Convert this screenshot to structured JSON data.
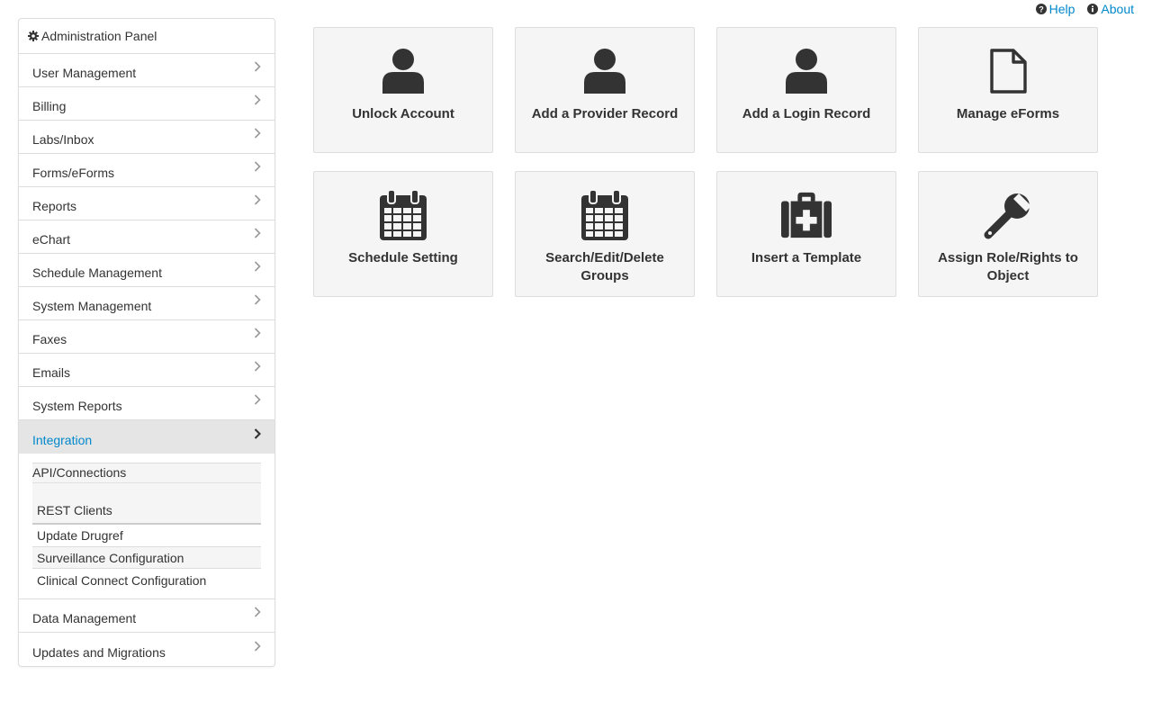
{
  "top_links": {
    "help": "Help",
    "about": "About"
  },
  "sidebar": {
    "heading": "Administration Panel",
    "items": [
      {
        "label": "User Management"
      },
      {
        "label": "Billing"
      },
      {
        "label": "Labs/Inbox"
      },
      {
        "label": "Forms/eForms"
      },
      {
        "label": "Reports"
      },
      {
        "label": "eChart"
      },
      {
        "label": "Schedule Management"
      },
      {
        "label": "System Management"
      },
      {
        "label": "Faxes"
      },
      {
        "label": "Emails"
      },
      {
        "label": "System Reports"
      },
      {
        "label": "Integration"
      },
      {
        "label": "Data Management"
      },
      {
        "label": "Updates and Migrations"
      }
    ],
    "integration_submenu": {
      "group_title": "API/Connections",
      "group_link": "REST Clients",
      "items": [
        "Update Drugref",
        "Surveillance Configuration",
        "Clinical Connect Configuration"
      ]
    }
  },
  "tiles": [
    {
      "label": "Unlock Account",
      "icon": "user-icon"
    },
    {
      "label": "Add a Provider Record",
      "icon": "user-icon"
    },
    {
      "label": "Add a Login Record",
      "icon": "user-icon"
    },
    {
      "label": "Manage eForms",
      "icon": "file-icon"
    },
    {
      "label": "Schedule Setting",
      "icon": "calendar-icon"
    },
    {
      "label": "Search/Edit/Delete Groups",
      "icon": "calendar-icon"
    },
    {
      "label": "Insert a Template",
      "icon": "medkit-icon"
    },
    {
      "label": "Assign Role/Rights to Object",
      "icon": "wrench-icon"
    }
  ],
  "colors": {
    "link": "#0088cc",
    "tile_bg": "#f5f5f5",
    "active_bg": "#e5e5e5",
    "icon": "#333333"
  }
}
